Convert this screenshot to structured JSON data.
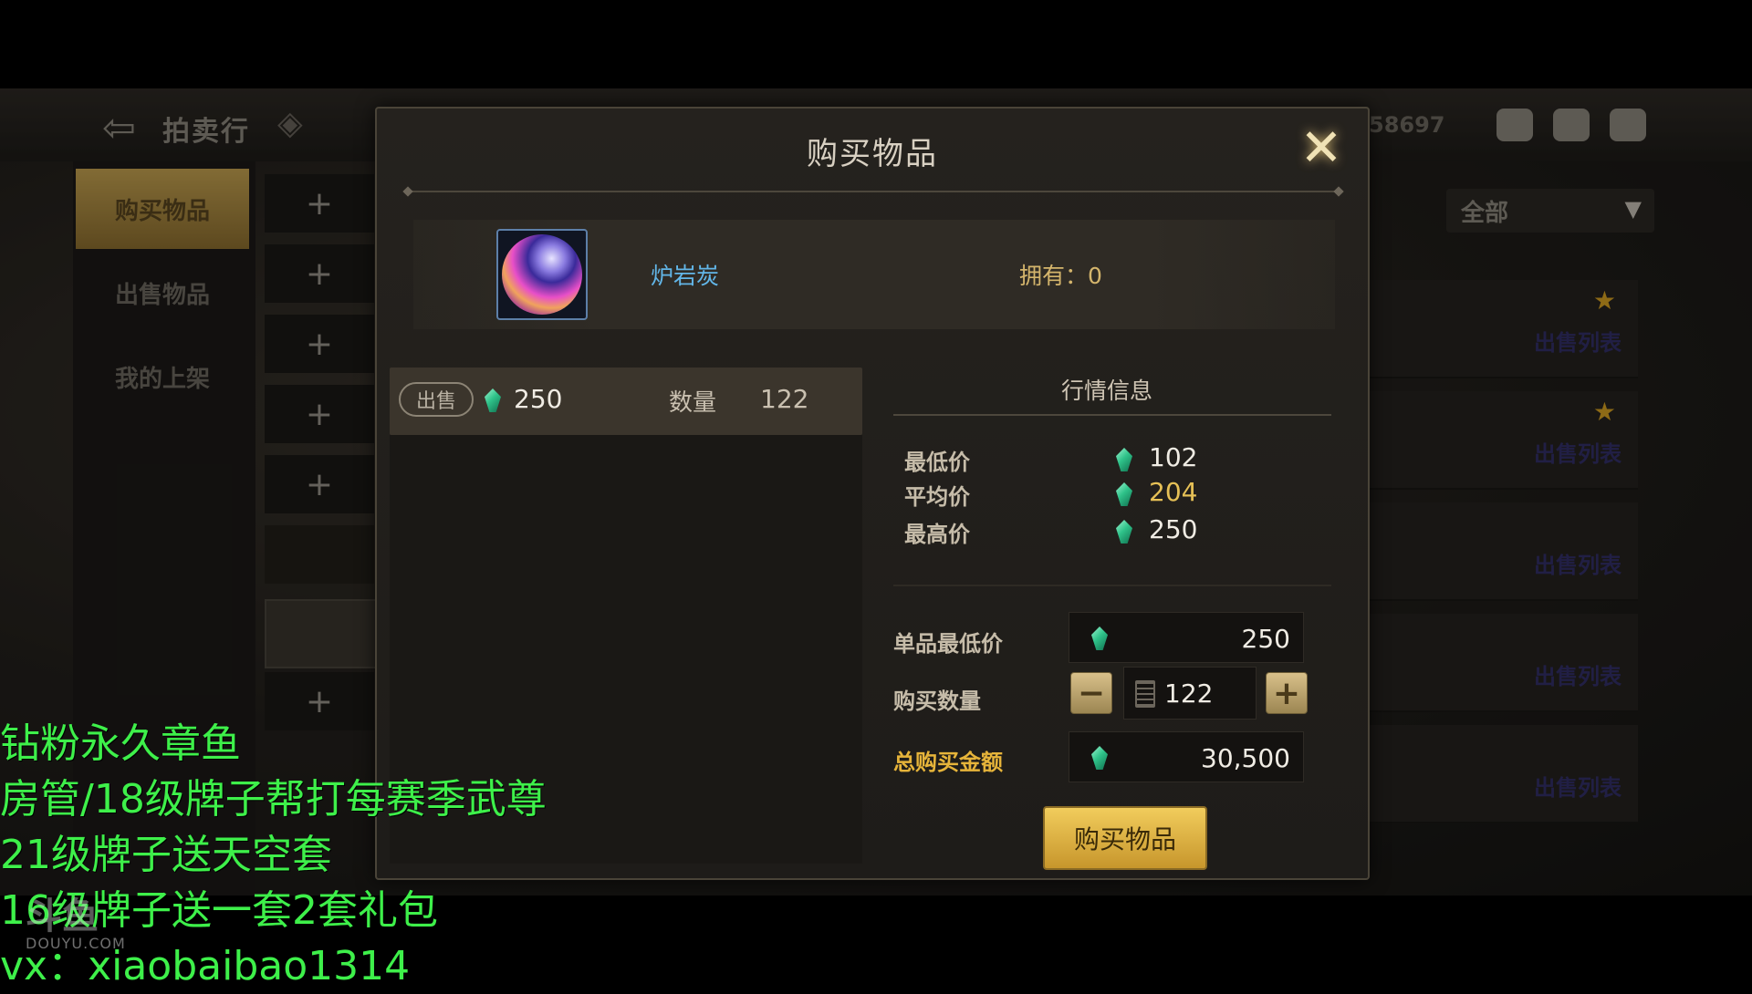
{
  "background": {
    "header_title": "拍卖行",
    "tabs": [
      "购买物品",
      "出售物品",
      "我的上架"
    ],
    "active_tab": "购买物品",
    "currency_partial": "58697",
    "filter_value": "全部",
    "row_action": "出售列表"
  },
  "dialog": {
    "title": "购买物品",
    "item": {
      "name": "炉岩炭",
      "owned_label": "拥有：0"
    },
    "listing": {
      "badge": "出售",
      "price": "250",
      "quantity_label": "数量",
      "quantity": "122"
    },
    "market": {
      "title": "行情信息",
      "rows": [
        {
          "label": "最低价",
          "value": "102"
        },
        {
          "label": "平均价",
          "value": "204"
        },
        {
          "label": "最高价",
          "value": "250"
        }
      ]
    },
    "form": {
      "unit_min_price_label": "单品最低价",
      "unit_min_price": "250",
      "buy_quantity_label": "购买数量",
      "minus": "−",
      "plus": "+",
      "buy_quantity": "122",
      "total_label": "总购买金额",
      "total": "30,500"
    },
    "buy_button": "购买物品",
    "colors": {
      "accent_gold": "#e6b43a",
      "gem_green": "#2fc38a",
      "item_name": "#62b6e8"
    }
  },
  "stream_overlay": {
    "lines": [
      "钻粉永久章鱼",
      "房管/18级牌子帮打每赛季武尊",
      "21级牌子送天空套",
      "16级牌子送一套2套礼包",
      "vx：xiaobaibao1314"
    ],
    "watermark_logo": "斗鱼",
    "watermark_url": "DOUYU.COM"
  }
}
